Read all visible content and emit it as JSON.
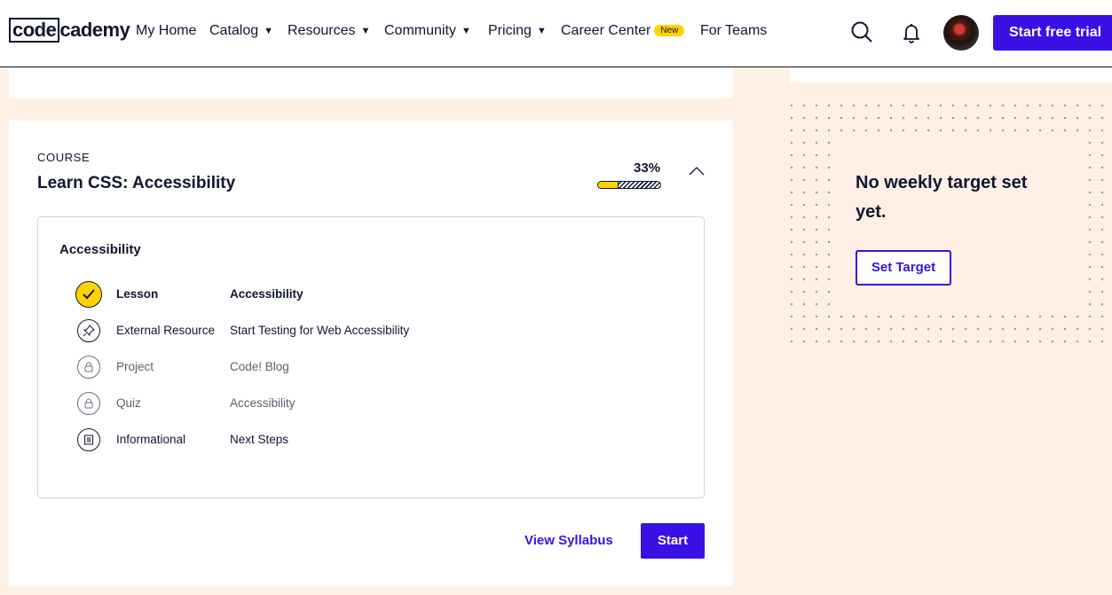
{
  "nav": {
    "logo_code": "code",
    "logo_rest": "cademy",
    "items": [
      {
        "label": "My Home"
      },
      {
        "label": "Catalog"
      },
      {
        "label": "Resources"
      },
      {
        "label": "Community"
      },
      {
        "label": "Pricing"
      },
      {
        "label": "Career Center",
        "badge": "New"
      },
      {
        "label": "For Teams"
      }
    ],
    "cta": "Start free trial"
  },
  "course": {
    "kicker": "COURSE",
    "title": "Learn CSS: Accessibility",
    "progress_label": "33%",
    "progress": 0.33,
    "module": {
      "title": "Accessibility",
      "items": [
        {
          "type": "Lesson",
          "name": "Accessibility",
          "state": "completed",
          "icon": "check-icon"
        },
        {
          "type": "External Resource",
          "name": "Start Testing for Web Accessibility",
          "state": "available",
          "icon": "pin-icon"
        },
        {
          "type": "Project",
          "name": "Code! Blog",
          "state": "locked",
          "icon": "lock-icon"
        },
        {
          "type": "Quiz",
          "name": "Accessibility",
          "state": "locked",
          "icon": "lock-icon"
        },
        {
          "type": "Informational",
          "name": "Next Steps",
          "state": "available",
          "icon": "document-icon"
        }
      ]
    },
    "view_syllabus": "View Syllabus",
    "start": "Start"
  },
  "weekly": {
    "message": "No weekly target set yet.",
    "button": "Set Target"
  },
  "colors": {
    "accent": "#3a10e5",
    "highlight": "#ffd300",
    "page_bg": "#fff0e5",
    "text": "#10162f"
  }
}
